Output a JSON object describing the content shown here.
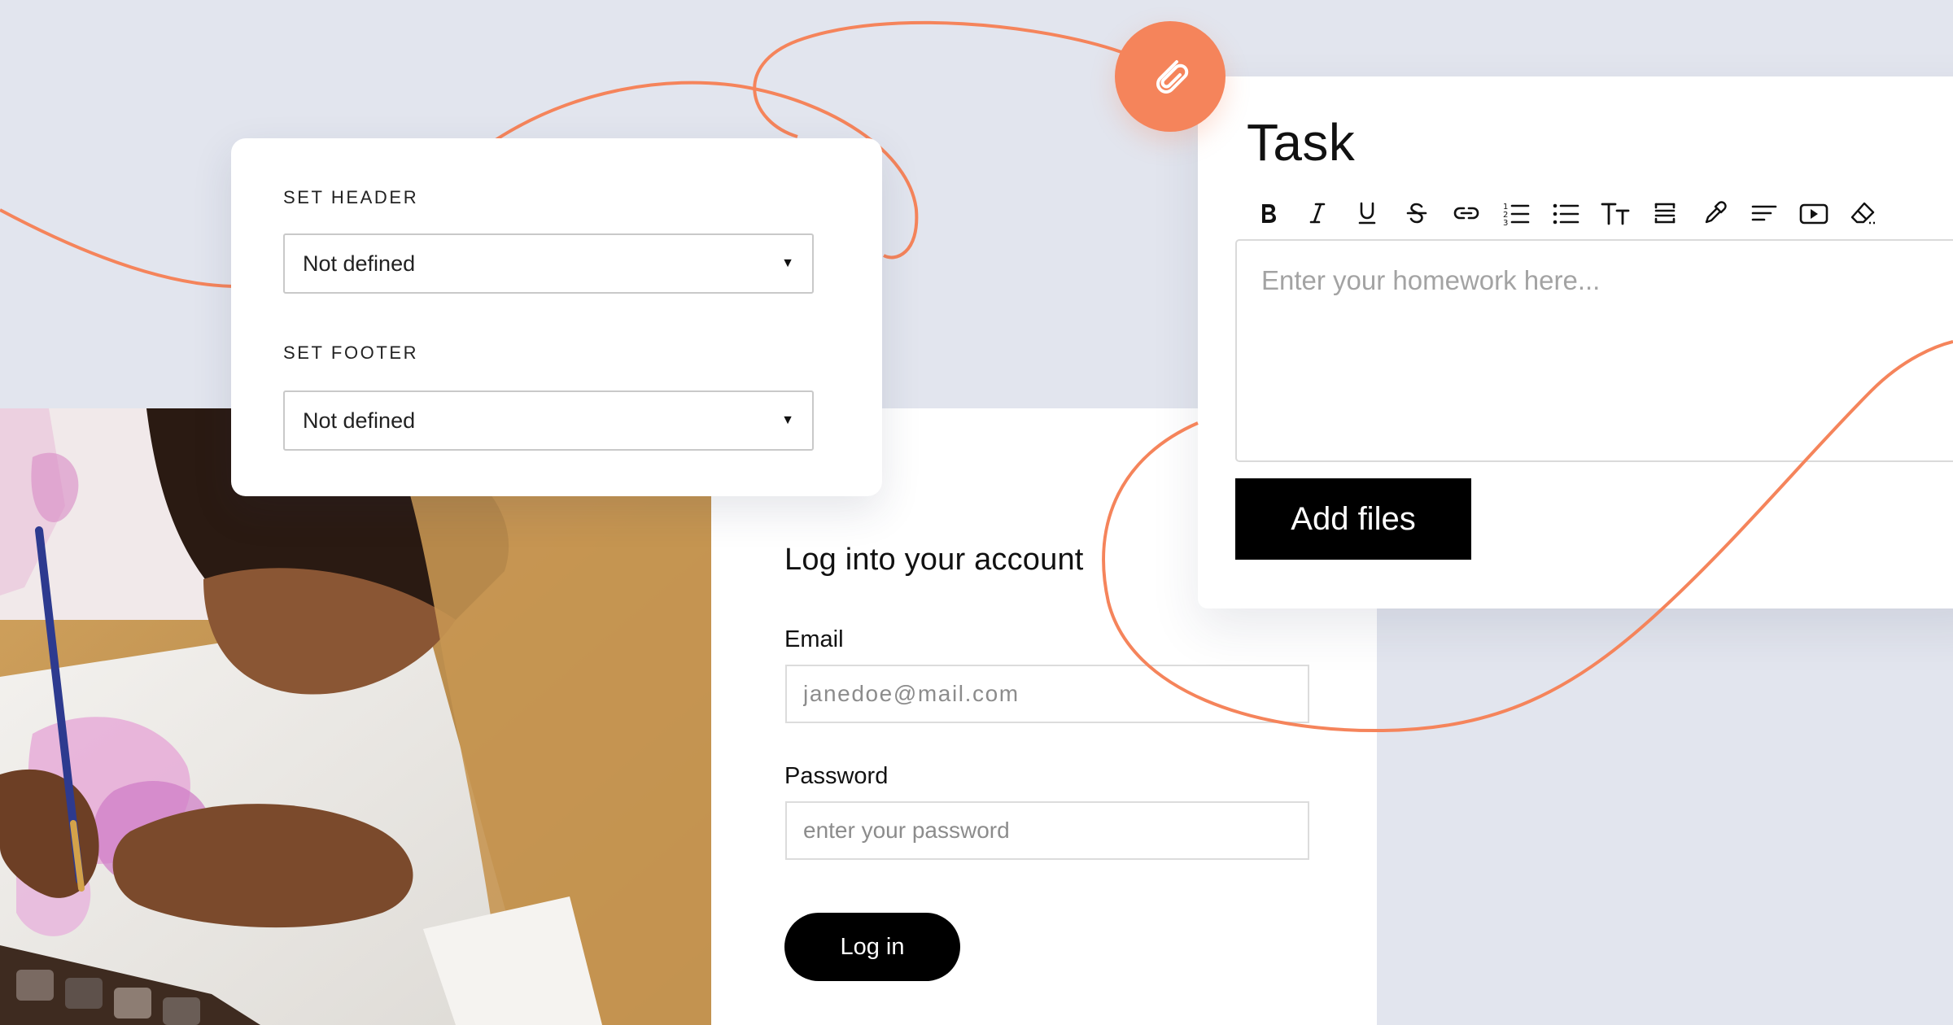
{
  "accent_color": "#f5845b",
  "settings": {
    "header_label": "SET HEADER",
    "header_value": "Not defined",
    "footer_label": "SET FOOTER",
    "footer_value": "Not defined"
  },
  "task": {
    "title": "Task",
    "toolbar": [
      "bold-icon",
      "italic-icon",
      "underline-icon",
      "strikethrough-icon",
      "link-icon",
      "numbered-list-icon",
      "bullet-list-icon",
      "text-size-icon",
      "spacing-icon",
      "color-picker-icon",
      "align-left-icon",
      "video-icon",
      "eraser-icon"
    ],
    "editor_placeholder": "Enter your homework here...",
    "add_files_label": "Add files"
  },
  "login": {
    "title": "Log into your account",
    "email_label": "Email",
    "email_placeholder": "janedoe@mail.com",
    "password_label": "Password",
    "password_placeholder": "enter your password",
    "button_label": "Log in"
  },
  "icons": {
    "attachment": "paperclip-icon",
    "dropdown": "caret-down-icon"
  }
}
